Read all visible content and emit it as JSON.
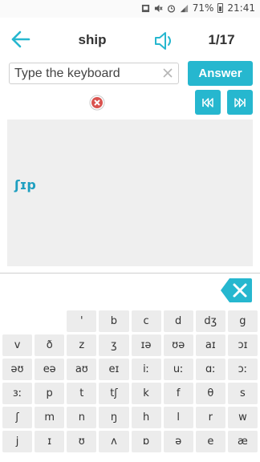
{
  "status_bar": {
    "battery": "71%",
    "time": "21:41"
  },
  "header": {
    "word": "ship",
    "counter": "1/17"
  },
  "input": {
    "placeholder": "Type the keyboard",
    "value": ""
  },
  "answer_label": "Answer",
  "content": {
    "phonetic": "ʃɪp"
  },
  "colors": {
    "accent": "#26b7cf",
    "phonetic": "#1e9fc0",
    "wrong": "#d9534f"
  },
  "keyboard": {
    "rows": [
      [
        "",
        "",
        "'",
        "b",
        "c",
        "d",
        "dʒ",
        "g"
      ],
      [
        "v",
        "ð",
        "z",
        "ʒ",
        "ɪə",
        "ʊə",
        "aɪ",
        "ɔɪ"
      ],
      [
        "əʊ",
        "eə",
        "aʊ",
        "eɪ",
        "iː",
        "uː",
        "ɑː",
        "ɔː"
      ],
      [
        "ɜː",
        "p",
        "t",
        "tʃ",
        "k",
        "f",
        "θ",
        "s"
      ],
      [
        "ʃ",
        "m",
        "n",
        "ŋ",
        "h",
        "l",
        "r",
        "w"
      ],
      [
        "j",
        "ɪ",
        "ʊ",
        "ʌ",
        "ɒ",
        "ə",
        "e",
        "æ"
      ]
    ]
  }
}
